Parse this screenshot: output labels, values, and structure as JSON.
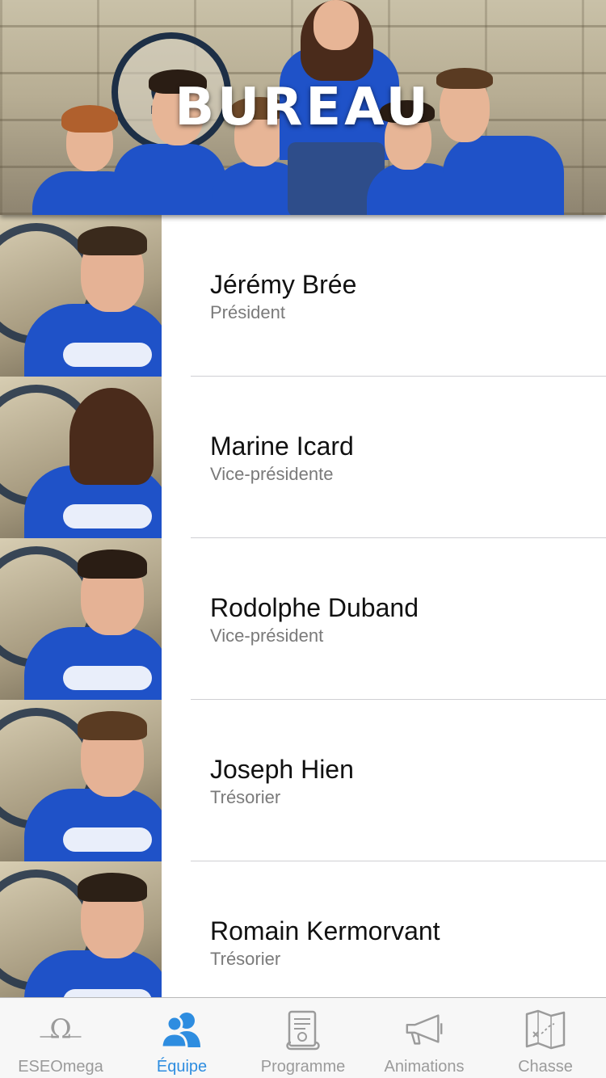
{
  "header": {
    "title": "BUREAU"
  },
  "members": [
    {
      "name": "Jérémy Brée",
      "role": "Président",
      "hair": "#3a2a1c"
    },
    {
      "name": "Marine Icard",
      "role": "Vice-présidente",
      "hair": "#4a2b1b"
    },
    {
      "name": "Rodolphe Duband",
      "role": "Vice-président",
      "hair": "#2a1d14"
    },
    {
      "name": "Joseph Hien",
      "role": "Trésorier",
      "hair": "#5a3b22"
    },
    {
      "name": "Romain Kermorvant",
      "role": "Trésorier",
      "hair": "#2c2016"
    }
  ],
  "tabbar": {
    "tabs": [
      {
        "label": "ESEOmega",
        "icon": "omega-icon",
        "active": false
      },
      {
        "label": "Équipe",
        "icon": "team-icon",
        "active": true
      },
      {
        "label": "Programme",
        "icon": "scroll-icon",
        "active": false
      },
      {
        "label": "Animations",
        "icon": "megaphone-icon",
        "active": false
      },
      {
        "label": "Chasse",
        "icon": "treasure-map-icon",
        "active": false
      }
    ]
  },
  "colors": {
    "accent": "#2e8de0",
    "inactive": "#9b9b9b",
    "shirt": "#1f52c8"
  }
}
